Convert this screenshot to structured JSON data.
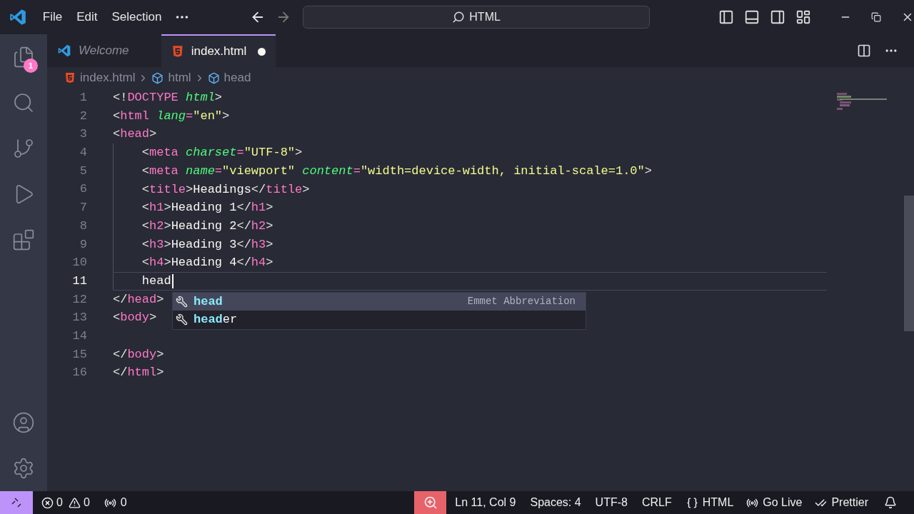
{
  "title_bar": {
    "menu": [
      "File",
      "Edit",
      "Selection"
    ],
    "search": "HTML"
  },
  "activity_bar": {
    "explorer_badge": "1"
  },
  "tabs": [
    {
      "label": "Welcome",
      "selected": false,
      "preview": true,
      "modified": false
    },
    {
      "label": "index.html",
      "selected": true,
      "preview": false,
      "modified": true
    }
  ],
  "breadcrumbs": [
    {
      "kind": "file",
      "label": "index.html"
    },
    {
      "kind": "element",
      "label": "html"
    },
    {
      "kind": "element",
      "label": "head"
    }
  ],
  "code_lines": [
    {
      "number": "1",
      "current": false,
      "tokens": [
        {
          "kind": "punct",
          "text": "<!"
        },
        {
          "kind": "tag",
          "text": "DOCTYPE "
        },
        {
          "kind": "attr",
          "text": "html"
        },
        {
          "kind": "punct",
          "text": ">"
        }
      ]
    },
    {
      "number": "2",
      "current": false,
      "tokens": [
        {
          "kind": "punct",
          "text": "<"
        },
        {
          "kind": "tag",
          "text": "html "
        },
        {
          "kind": "attr",
          "text": "lang"
        },
        {
          "kind": "tag",
          "text": "="
        },
        {
          "kind": "str",
          "text": "\"en\""
        },
        {
          "kind": "punct",
          "text": ">"
        }
      ]
    },
    {
      "number": "3",
      "current": false,
      "tokens": [
        {
          "kind": "punct",
          "text": "<"
        },
        {
          "kind": "tag",
          "text": "head"
        },
        {
          "kind": "punct",
          "text": ">"
        }
      ]
    },
    {
      "number": "4",
      "current": false,
      "tokens": [
        {
          "kind": "punct",
          "text": "    <"
        },
        {
          "kind": "tag",
          "text": "meta "
        },
        {
          "kind": "attr",
          "text": "charset"
        },
        {
          "kind": "tag",
          "text": "="
        },
        {
          "kind": "str",
          "text": "\"UTF-8\""
        },
        {
          "kind": "punct",
          "text": ">"
        }
      ]
    },
    {
      "number": "5",
      "current": false,
      "tokens": [
        {
          "kind": "punct",
          "text": "    <"
        },
        {
          "kind": "tag",
          "text": "meta "
        },
        {
          "kind": "attr",
          "text": "name"
        },
        {
          "kind": "tag",
          "text": "="
        },
        {
          "kind": "str",
          "text": "\"viewport\" "
        },
        {
          "kind": "attr",
          "text": "content"
        },
        {
          "kind": "tag",
          "text": "="
        },
        {
          "kind": "str",
          "text": "\"width=device-width, initial-scale=1.0\""
        },
        {
          "kind": "punct",
          "text": ">"
        }
      ]
    },
    {
      "number": "6",
      "current": false,
      "tokens": [
        {
          "kind": "punct",
          "text": "    <"
        },
        {
          "kind": "tag",
          "text": "title"
        },
        {
          "kind": "punct",
          "text": ">"
        },
        {
          "kind": "text",
          "text": "Headings"
        },
        {
          "kind": "punct",
          "text": "</"
        },
        {
          "kind": "tag",
          "text": "title"
        },
        {
          "kind": "punct",
          "text": ">"
        }
      ]
    },
    {
      "number": "7",
      "current": false,
      "tokens": [
        {
          "kind": "punct",
          "text": "    <"
        },
        {
          "kind": "tag",
          "text": "h1"
        },
        {
          "kind": "punct",
          "text": ">"
        },
        {
          "kind": "text",
          "text": "Heading 1"
        },
        {
          "kind": "punct",
          "text": "</"
        },
        {
          "kind": "tag",
          "text": "h1"
        },
        {
          "kind": "punct",
          "text": ">"
        }
      ]
    },
    {
      "number": "8",
      "current": false,
      "tokens": [
        {
          "kind": "punct",
          "text": "    <"
        },
        {
          "kind": "tag",
          "text": "h2"
        },
        {
          "kind": "punct",
          "text": ">"
        },
        {
          "kind": "text",
          "text": "Heading 2"
        },
        {
          "kind": "punct",
          "text": "</"
        },
        {
          "kind": "tag",
          "text": "h2"
        },
        {
          "kind": "punct",
          "text": ">"
        }
      ]
    },
    {
      "number": "9",
      "current": false,
      "tokens": [
        {
          "kind": "punct",
          "text": "    <"
        },
        {
          "kind": "tag",
          "text": "h3"
        },
        {
          "kind": "punct",
          "text": ">"
        },
        {
          "kind": "text",
          "text": "Heading 3"
        },
        {
          "kind": "punct",
          "text": "</"
        },
        {
          "kind": "tag",
          "text": "h3"
        },
        {
          "kind": "punct",
          "text": ">"
        }
      ]
    },
    {
      "number": "10",
      "current": false,
      "tokens": [
        {
          "kind": "punct",
          "text": "    <"
        },
        {
          "kind": "tag",
          "text": "h4"
        },
        {
          "kind": "punct",
          "text": ">"
        },
        {
          "kind": "text",
          "text": "Heading 4"
        },
        {
          "kind": "punct",
          "text": "</"
        },
        {
          "kind": "tag",
          "text": "h4"
        },
        {
          "kind": "punct",
          "text": ">"
        }
      ]
    },
    {
      "number": "11",
      "current": true,
      "tokens": [
        {
          "kind": "text",
          "text": "    head"
        }
      ]
    },
    {
      "number": "12",
      "current": false,
      "tokens": [
        {
          "kind": "punct",
          "text": "</"
        },
        {
          "kind": "tag",
          "text": "head"
        },
        {
          "kind": "punct",
          "text": ">"
        }
      ]
    },
    {
      "number": "13",
      "current": false,
      "tokens": [
        {
          "kind": "punct",
          "text": "<"
        },
        {
          "kind": "tag",
          "text": "body"
        },
        {
          "kind": "punct",
          "text": ">"
        }
      ]
    },
    {
      "number": "14",
      "current": false
    },
    {
      "number": "15",
      "current": false,
      "tokens": [
        {
          "kind": "punct",
          "text": "</"
        },
        {
          "kind": "tag",
          "text": "body"
        },
        {
          "kind": "punct",
          "text": ">"
        }
      ]
    },
    {
      "number": "16",
      "current": false,
      "tokens": [
        {
          "kind": "punct",
          "text": "</"
        },
        {
          "kind": "tag",
          "text": "html"
        },
        {
          "kind": "punct",
          "text": ">"
        }
      ]
    }
  ],
  "suggestions": [
    {
      "match": "head",
      "detail": "Emmet Abbreviation",
      "selected": true
    },
    {
      "match": "head",
      "rest": "er",
      "selected": false
    }
  ],
  "status_bar": {
    "errors": "0",
    "warnings": "0",
    "ports": "0",
    "position": "Ln 11, Col 9",
    "indent": "Spaces: 4",
    "encoding": "UTF-8",
    "eol": "CRLF",
    "language": "HTML",
    "go_live": "Go Live",
    "formatter": "Prettier"
  }
}
